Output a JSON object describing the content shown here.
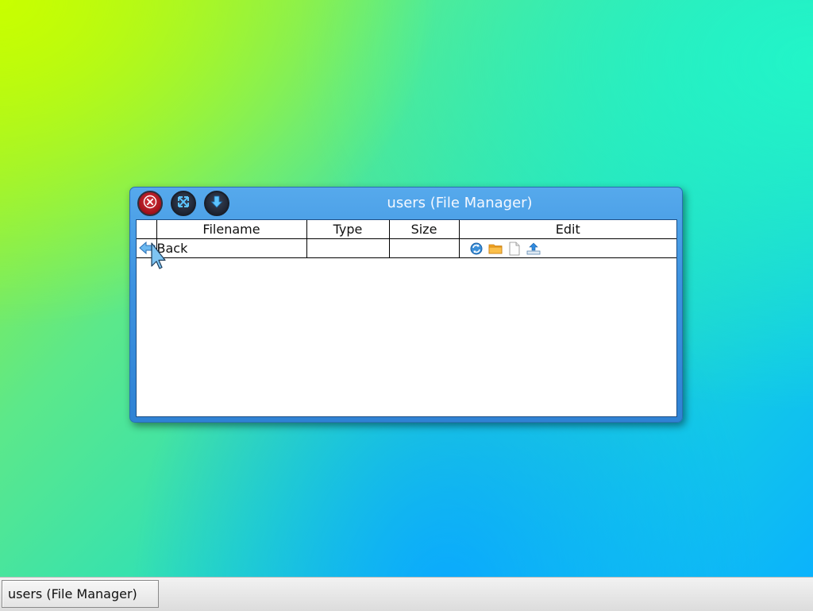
{
  "window": {
    "title": "users (File Manager)"
  },
  "table": {
    "headers": [
      "",
      "Filename",
      "Type",
      "Size",
      "Edit"
    ],
    "rows": [
      {
        "icon": "back-arrow-icon",
        "filename": "Back",
        "type": "",
        "size": ""
      }
    ]
  },
  "edit_icons": [
    "refresh-icon",
    "new-folder-icon",
    "new-file-icon",
    "upload-icon"
  ],
  "taskbar": {
    "items": [
      {
        "label": "users (File Manager)"
      }
    ]
  },
  "colors": {
    "titlebar": "#3d93e0",
    "close_button": "#c0202a",
    "window_button": "#1c2230"
  }
}
